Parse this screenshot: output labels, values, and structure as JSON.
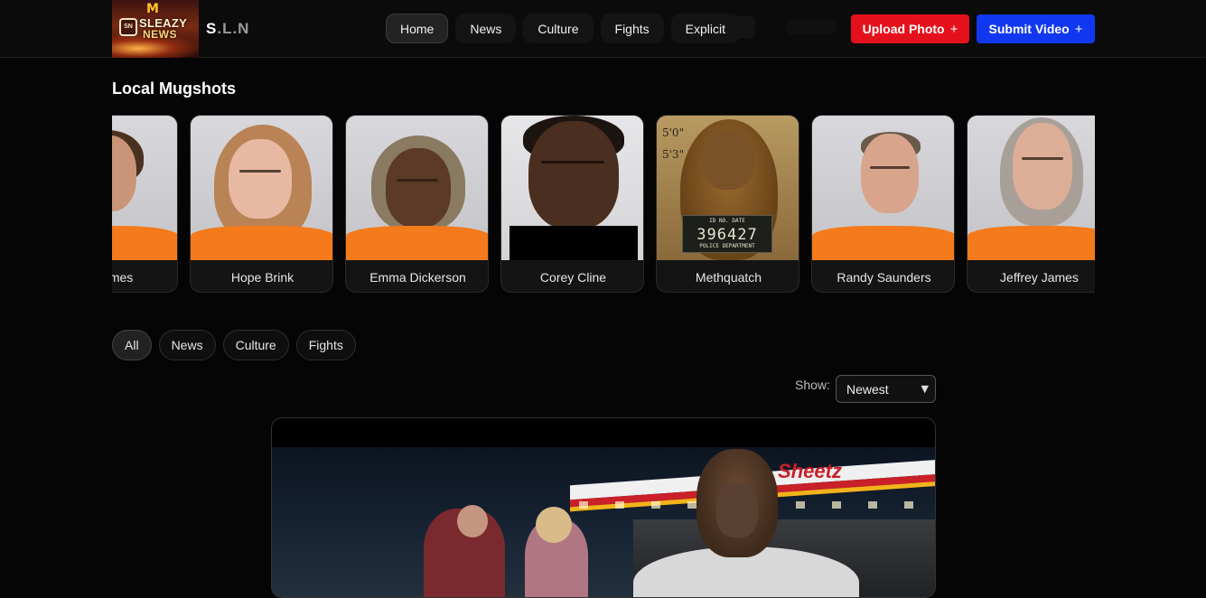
{
  "header": {
    "logo": {
      "line1": "SLEAZY",
      "line2": "NEWS",
      "badge": "SN"
    },
    "site_name_first": "S",
    "site_name_rest": ".L.N",
    "nav": [
      {
        "label": "Home",
        "active": true
      },
      {
        "label": "News",
        "active": false
      },
      {
        "label": "Culture",
        "active": false
      },
      {
        "label": "Fights",
        "active": false
      },
      {
        "label": "Explicit",
        "active": false
      }
    ],
    "upload_label": "Upload Photo",
    "submit_label": "Submit Video",
    "plus_glyph": "+",
    "colors": {
      "upload": "#e4111c",
      "submit": "#1138f0"
    }
  },
  "mugshots": {
    "title": "Local Mugshots",
    "items": [
      {
        "name": "Groomes"
      },
      {
        "name": "Hope Brink"
      },
      {
        "name": "Emma Dickerson"
      },
      {
        "name": "Corey Cline"
      },
      {
        "name": "Methquatch",
        "board_number": "396427",
        "board_top": "ID NO.     DATE",
        "board_bottom": "POLICE DEPARTMENT",
        "heights": [
          "5'0\"",
          "5'3\""
        ]
      },
      {
        "name": "Randy Saunders"
      },
      {
        "name": "Jeffrey James"
      }
    ]
  },
  "filters": {
    "chips": [
      {
        "label": "All",
        "active": true
      },
      {
        "label": "News",
        "active": false
      },
      {
        "label": "Culture",
        "active": false
      },
      {
        "label": "Fights",
        "active": false
      }
    ],
    "show_label": "Show:",
    "show_value": "Newest"
  },
  "video": {
    "sign_text": "Sheetz"
  }
}
